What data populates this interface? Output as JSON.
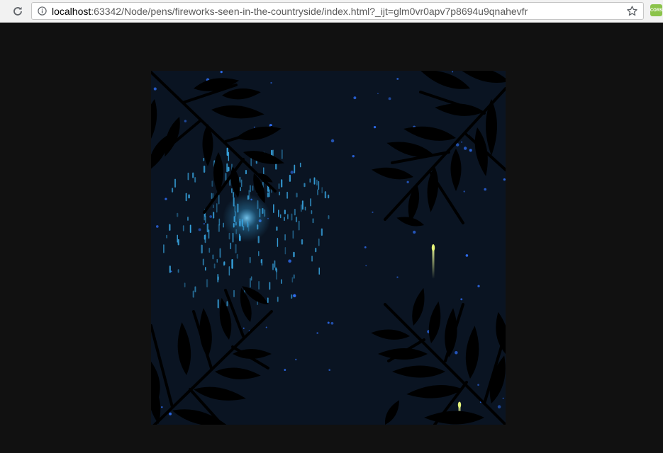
{
  "browser": {
    "url_host": "localhost",
    "url_rest": ":63342/Node/pens/fireworks-seen-in-the-countryside/index.html?_ijt=glm0vr0apv7p8694u9qnahevfr",
    "extension_label": "CORS",
    "reload_icon": "reload-icon",
    "info_icon": "info-icon",
    "star_icon": "star-icon"
  },
  "scene": {
    "background": "#0a1422",
    "page_background": "#111111",
    "leaf_color": "#000000",
    "firework_color": "#39a9e6",
    "star_color": "#2e6df0",
    "rocket_color": "#e6f57a"
  }
}
